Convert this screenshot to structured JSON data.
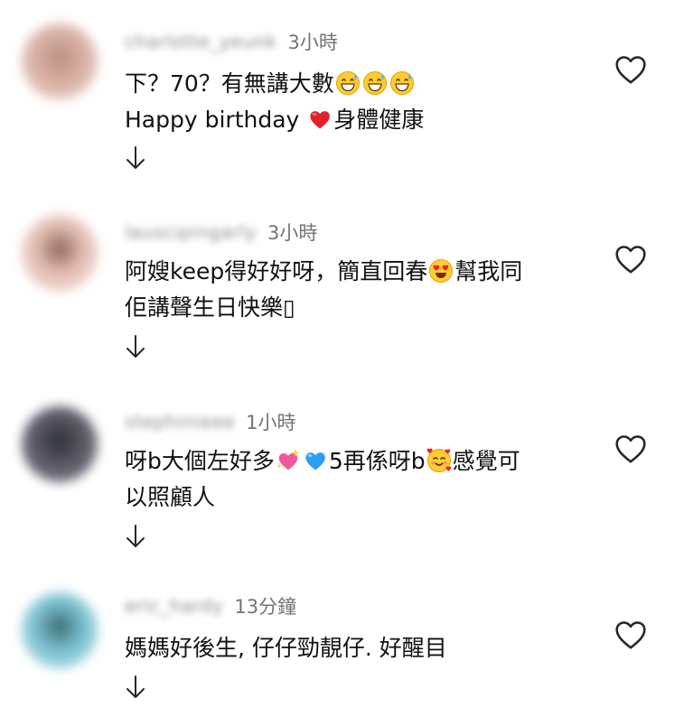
{
  "comments": [
    {
      "username": "charlotte_yeunk",
      "time": "3小時",
      "lines": [
        [
          {
            "t": "下？70？有無講大數"
          },
          {
            "e": "grin-sweat"
          },
          {
            "e": "grin-sweat"
          },
          {
            "e": "grin-sweat"
          }
        ],
        [
          {
            "t": "Happy birthday "
          },
          {
            "e": "red-heart"
          },
          {
            "t": "身體健康"
          }
        ]
      ],
      "avatar_colors": [
        "#d9b1a6",
        "#b98e7d",
        "#ead6c8"
      ]
    },
    {
      "username": "lauscipingarly",
      "time": "3小時",
      "lines": [
        [
          {
            "t": "阿嫂keep得好好呀，簡直回春"
          },
          {
            "e": "heart-eyes"
          },
          {
            "t": "幫我同"
          }
        ],
        [
          {
            "t": "佢講聲生日快樂▯"
          }
        ]
      ],
      "avatar_colors": [
        "#e6c1b8",
        "#8c6659",
        "#f0d8cf"
      ]
    },
    {
      "username": "stephinieee",
      "time": "1小時",
      "lines": [
        [
          {
            "t": "呀b大個左好多"
          },
          {
            "e": "sparkling-heart"
          },
          {
            "e": "blue-heart"
          },
          {
            "t": "5再係呀b"
          },
          {
            "e": "smiling-hearts"
          },
          {
            "t": "感覺可"
          }
        ],
        [
          {
            "t": "以照顧人"
          }
        ]
      ],
      "avatar_colors": [
        "#5b5b66",
        "#2f2f38",
        "#8d8394"
      ]
    },
    {
      "username": "eric_hardy",
      "time": "13分鐘",
      "lines": [
        [
          {
            "t": "媽媽好後生, 仔仔勁靚仔. 好醒目"
          }
        ]
      ],
      "avatar_colors": [
        "#7ec3d2",
        "#3a6b70",
        "#bfe3ea"
      ]
    }
  ],
  "icons": {
    "like": "heart-outline-icon",
    "translate": "arrow-down-icon"
  },
  "colors": {
    "text": "#111111",
    "meta": "#737373",
    "icon": "#262626"
  }
}
